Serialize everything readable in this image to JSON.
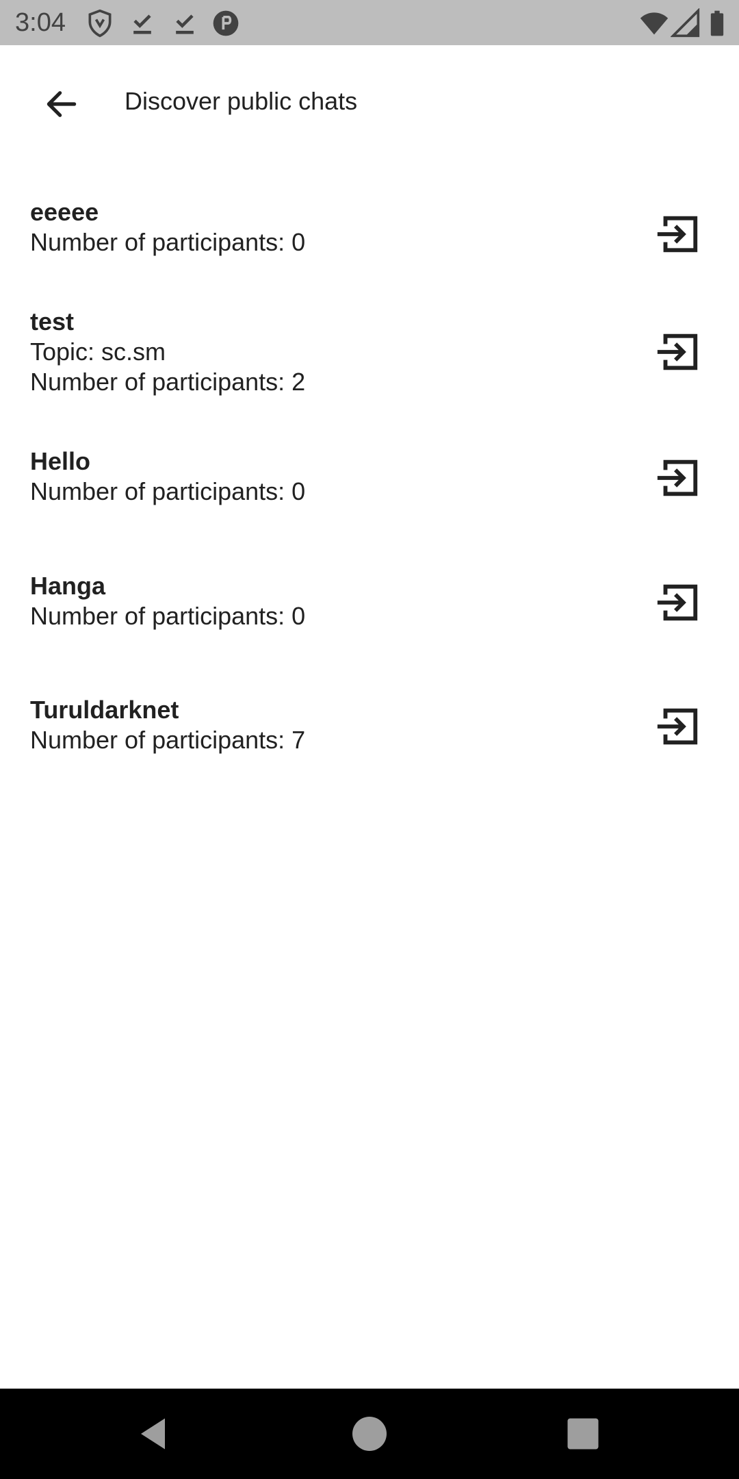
{
  "status_bar": {
    "time": "3:04",
    "icons": [
      "shield-icon",
      "check-download-icon",
      "check-download-icon",
      "rounded-app-icon",
      "wifi-icon",
      "signal-icon",
      "battery-icon"
    ]
  },
  "app_bar": {
    "title": "Discover public chats",
    "back_icon": "arrow-left-icon"
  },
  "chats": [
    {
      "name": "eeeee",
      "lines": [
        "Number of participants: 0"
      ]
    },
    {
      "name": "test",
      "lines": [
        "Topic: sc.sm",
        "Number of participants: 2"
      ]
    },
    {
      "name": "Hello",
      "lines": [
        "Number of participants: 0"
      ]
    },
    {
      "name": "Hanga",
      "lines": [
        "Number of participants: 0"
      ]
    },
    {
      "name": "Turuldarknet",
      "lines": [
        "Number of participants: 7"
      ]
    }
  ],
  "join_icon": "login-icon",
  "nav_bar": {
    "icons": [
      "back-triangle-icon",
      "home-circle-icon",
      "recents-square-icon"
    ]
  },
  "colors": {
    "status_bar": "#bdbdbd",
    "nav_bar": "#000000",
    "text": "#212121"
  }
}
